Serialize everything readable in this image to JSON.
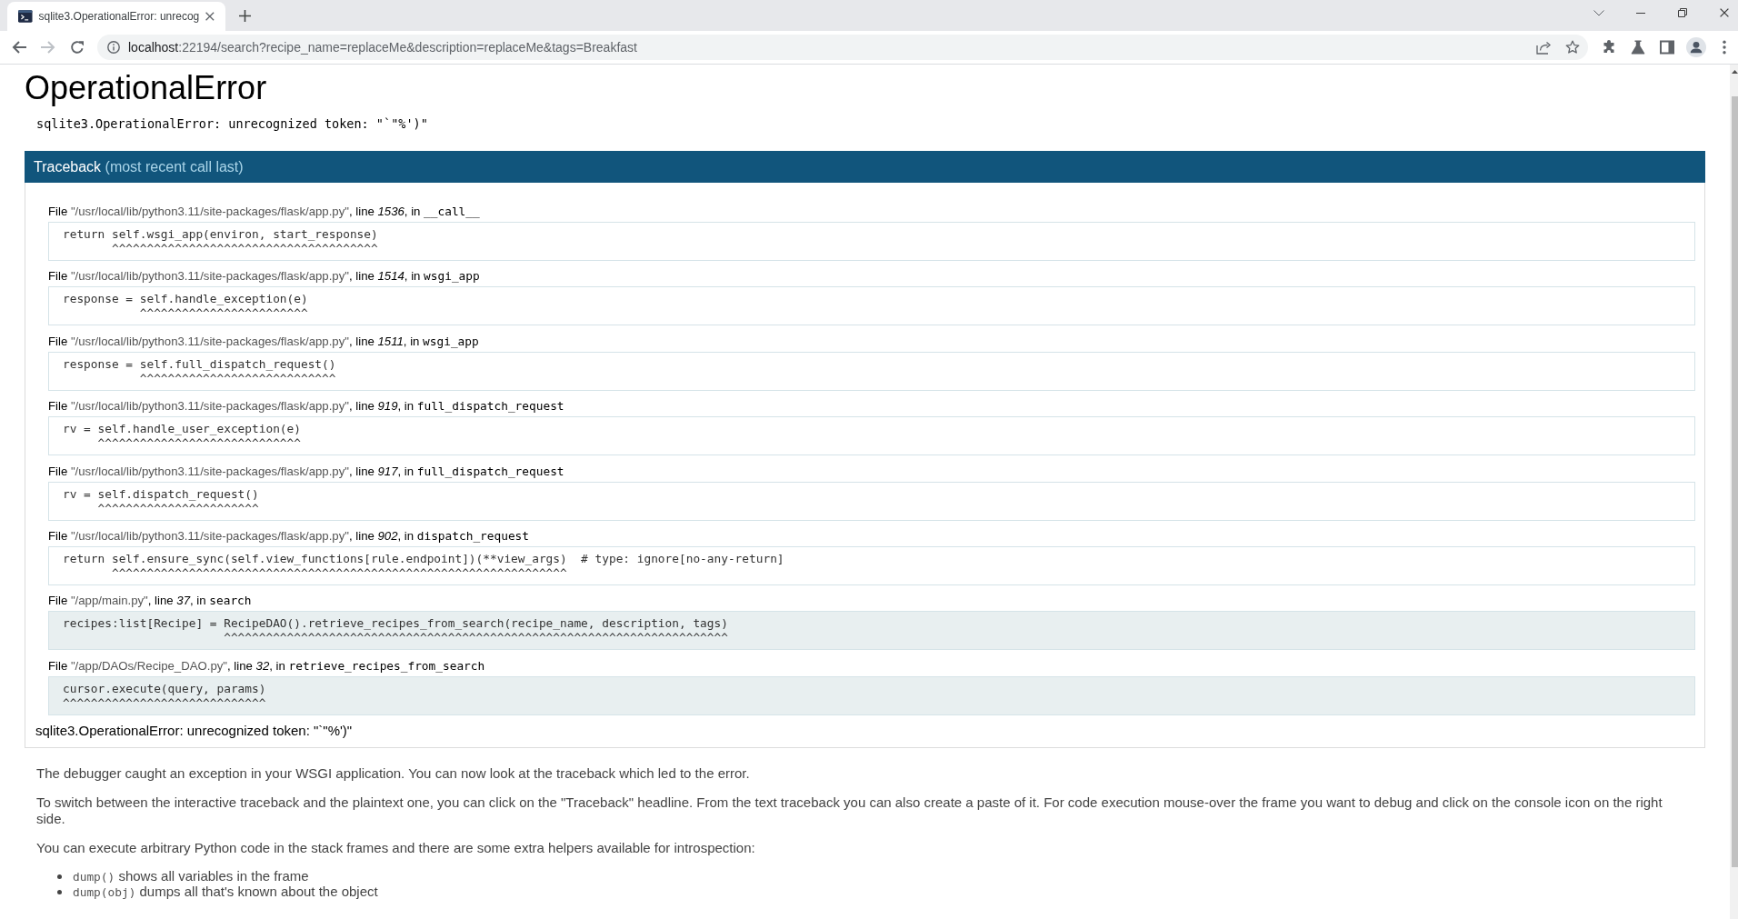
{
  "browser": {
    "tabs": [
      {
        "title": "sqlite3.OperationalError: unrecog",
        "selected": true
      }
    ],
    "navigation": {
      "back": {
        "disabled": false
      },
      "forward": {
        "disabled": true
      }
    },
    "address": {
      "host": "localhost",
      "path": ":22194/search?recipe_name=replaceMe&description=replaceMe&tags=Breakfast"
    }
  },
  "page": {
    "title": "OperationalError",
    "error": "sqlite3.OperationalError: unrecognized token: \"`\"%')\"",
    "traceback": {
      "heading": "Traceback",
      "heading_note": "(most recent call last)",
      "frames": [
        {
          "kind": "library",
          "file_word": "File",
          "filename": "\"/usr/local/lib/python3.11/site-packages/flask/app.py\"",
          "line_word": ", line",
          "line": "1536",
          "in_word": ", in",
          "function": "__call__",
          "code": "return self.wsgi_app(environ, start_response)",
          "marker": "       ^^^^^^^^^^^^^^^^^^^^^^^^^^^^^^^^^^^^^^"
        },
        {
          "kind": "library",
          "file_word": "File",
          "filename": "\"/usr/local/lib/python3.11/site-packages/flask/app.py\"",
          "line_word": ", line",
          "line": "1514",
          "in_word": ", in",
          "function": "wsgi_app",
          "code": "response = self.handle_exception(e)",
          "marker": "           ^^^^^^^^^^^^^^^^^^^^^^^^"
        },
        {
          "kind": "library",
          "file_word": "File",
          "filename": "\"/usr/local/lib/python3.11/site-packages/flask/app.py\"",
          "line_word": ", line",
          "line": "1511",
          "in_word": ", in",
          "function": "wsgi_app",
          "code": "response = self.full_dispatch_request()",
          "marker": "           ^^^^^^^^^^^^^^^^^^^^^^^^^^^^"
        },
        {
          "kind": "library",
          "file_word": "File",
          "filename": "\"/usr/local/lib/python3.11/site-packages/flask/app.py\"",
          "line_word": ", line",
          "line": "919",
          "in_word": ", in",
          "function": "full_dispatch_request",
          "code": "rv = self.handle_user_exception(e)",
          "marker": "     ^^^^^^^^^^^^^^^^^^^^^^^^^^^^^"
        },
        {
          "kind": "library",
          "file_word": "File",
          "filename": "\"/usr/local/lib/python3.11/site-packages/flask/app.py\"",
          "line_word": ", line",
          "line": "917",
          "in_word": ", in",
          "function": "full_dispatch_request",
          "code": "rv = self.dispatch_request()",
          "marker": "     ^^^^^^^^^^^^^^^^^^^^^^^"
        },
        {
          "kind": "library",
          "file_word": "File",
          "filename": "\"/usr/local/lib/python3.11/site-packages/flask/app.py\"",
          "line_word": ", line",
          "line": "902",
          "in_word": ", in",
          "function": "dispatch_request",
          "code": "return self.ensure_sync(self.view_functions[rule.endpoint])(**view_args)  # type: ignore[no-any-return]",
          "marker": "       ^^^^^^^^^^^^^^^^^^^^^^^^^^^^^^^^^^^^^^^^^^^^^^^^^^^^^^^^^^^^^^^^^"
        },
        {
          "kind": "application",
          "file_word": "File",
          "filename": "\"/app/main.py\"",
          "line_word": ", line",
          "line": "37",
          "in_word": ", in",
          "function": "search",
          "code": "recipes:list[Recipe] = RecipeDAO().retrieve_recipes_from_search(recipe_name, description, tags)",
          "marker": "                       ^^^^^^^^^^^^^^^^^^^^^^^^^^^^^^^^^^^^^^^^^^^^^^^^^^^^^^^^^^^^^^^^^^^^^^^^"
        },
        {
          "kind": "application",
          "file_word": "File",
          "filename": "\"/app/DAOs/Recipe_DAO.py\"",
          "line_word": ", line",
          "line": "32",
          "in_word": ", in",
          "function": "retrieve_recipes_from_search",
          "code": "cursor.execute(query, params)",
          "marker": "^^^^^^^^^^^^^^^^^^^^^^^^^^^^^"
        }
      ],
      "exception": "sqlite3.OperationalError: unrecognized token: \"`\"%')\""
    },
    "explanation": [
      "The debugger caught an exception in your WSGI application. You can now look at the traceback which led to the error.",
      "To switch between the interactive traceback and the plaintext one, you can click on the \"Traceback\" headline. From the text traceback you can also create a paste of it. For code execution mouse-over the frame you want to debug and click on the console icon on the right side.",
      "You can execute arbitrary Python code in the stack frames and there are some extra helpers available for introspection:"
    ],
    "helpers": [
      {
        "code": "dump()",
        "text": "shows all variables in the frame"
      },
      {
        "code": "dump(obj)",
        "text": "dumps all that's known about the object"
      }
    ]
  }
}
